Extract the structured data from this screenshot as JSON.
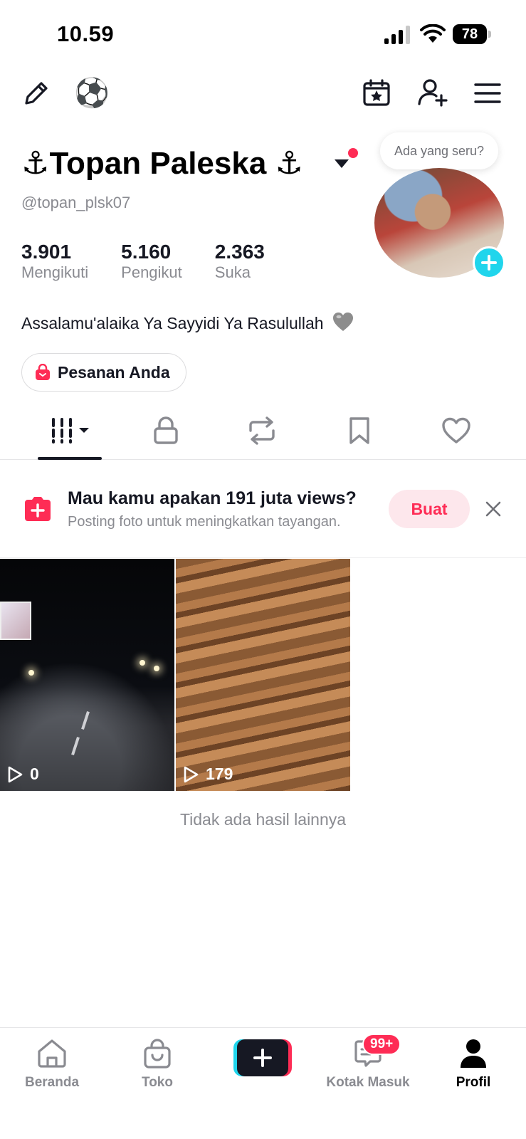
{
  "status_bar": {
    "time": "10.59",
    "battery": "78"
  },
  "top_bar": {
    "emoji": "⚽"
  },
  "profile": {
    "name": "⚓Topan Paleska ⚓",
    "handle": "@topan_plsk07",
    "bubble": "Ada yang seru?",
    "stats": [
      {
        "value": "3.901",
        "label": "Mengikuti"
      },
      {
        "value": "5.160",
        "label": "Pengikut"
      },
      {
        "value": "2.363",
        "label": "Suka"
      }
    ],
    "bio": "Assalamu'alaika Ya Sayyidi Ya Rasulullah",
    "orders_label": "Pesanan Anda"
  },
  "banner": {
    "title": "Mau kamu apakan 191 juta views?",
    "subtitle": "Posting foto untuk meningkatkan tayangan.",
    "button": "Buat"
  },
  "videos": [
    {
      "views": "0"
    },
    {
      "views": "179"
    }
  ],
  "no_more": "Tidak ada hasil lainnya",
  "bottom_nav": {
    "home": "Beranda",
    "shop": "Toko",
    "inbox": "Kotak Masuk",
    "inbox_badge": "99+",
    "profile": "Profil"
  },
  "colors": {
    "accent": "#fe2c55",
    "cyan": "#20d5ec",
    "text": "#161823",
    "muted": "#8a8b91"
  }
}
